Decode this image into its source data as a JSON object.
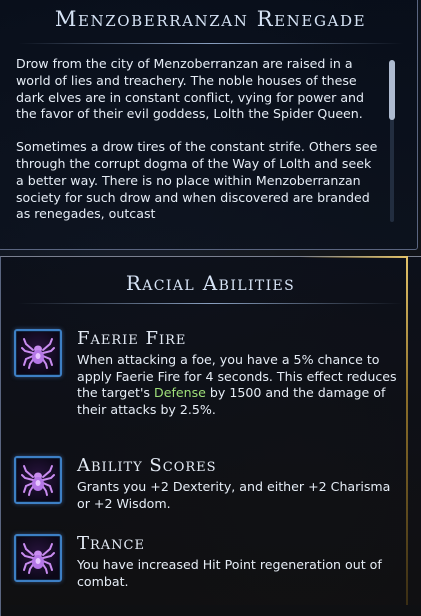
{
  "race": {
    "title": "Menzoberranzan Renegade",
    "description": [
      "Drow from the city of Menzoberranzan are raised in a world of lies and treachery. The noble houses of these dark elves are in constant conflict, vying for power and the favor of their evil goddess, Lolth the Spider Queen.",
      "Sometimes a drow tires of the constant strife. Others see through the corrupt dogma of the Way of Lolth and seek a better way. There is no place within Menzoberranzan society for such drow and when discovered are branded as renegades, outcast"
    ]
  },
  "abilities_section": {
    "title": "Racial Abilities",
    "items": [
      {
        "name": "Faerie Fire",
        "icon": "spider-icon",
        "text_before": "When attacking a foe, you have a 5% chance to apply Faerie Fire for 4 seconds. This effect reduces the target's ",
        "keyword": "Defense",
        "text_after": " by 1500 and the damage of their attacks by 2.5%."
      },
      {
        "name": "Ability Scores",
        "icon": "spider-icon",
        "text": "Grants you +2 Dexterity, and either +2 Charisma or +2 Wisdom."
      },
      {
        "name": "Trance",
        "icon": "spider-icon",
        "text": "You have increased Hit Point regeneration out of combat."
      }
    ]
  },
  "colors": {
    "keyword": "#9fe07a",
    "icon_border": "#3d7fc4",
    "spider": "#c98cf0",
    "accent_gold": "#e4c46a"
  }
}
